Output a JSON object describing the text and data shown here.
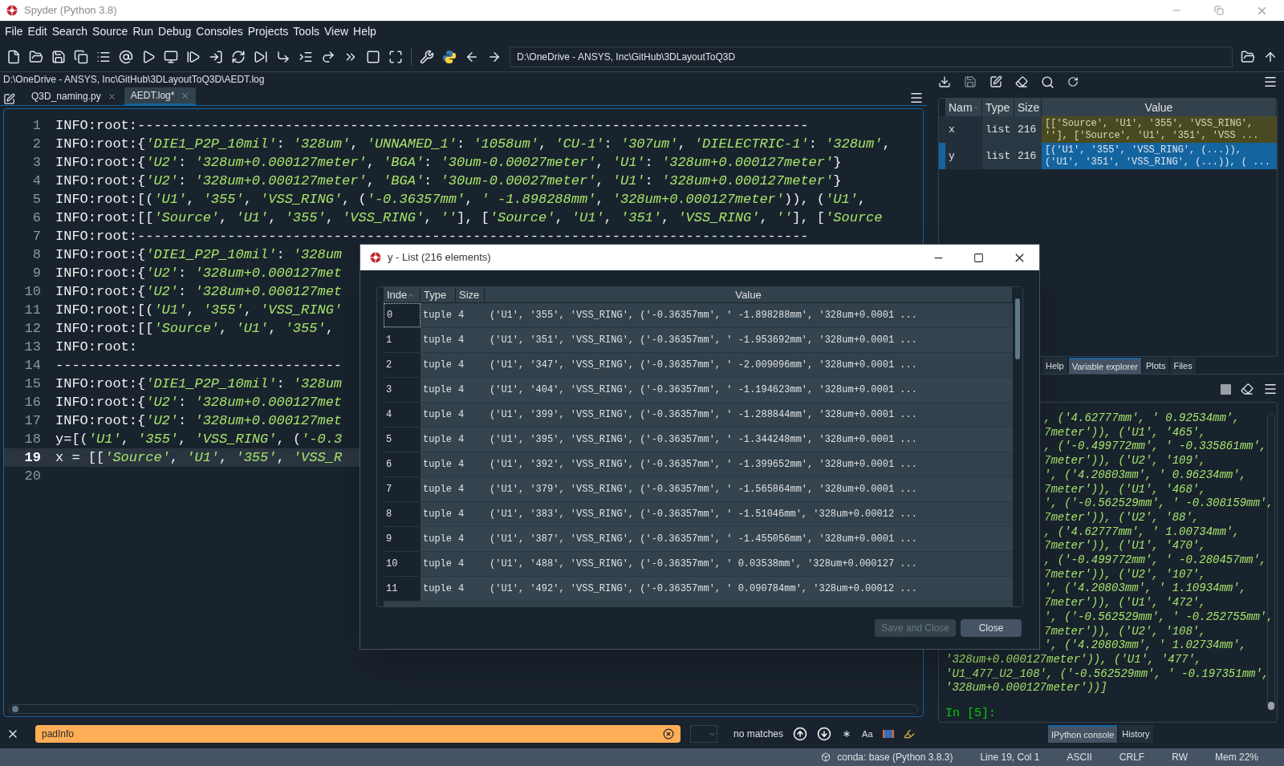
{
  "window": {
    "title": "Spyder (Python 3.8)"
  },
  "menu": [
    "File",
    "Edit",
    "Search",
    "Source",
    "Run",
    "Debug",
    "Consoles",
    "Projects",
    "Tools",
    "View",
    "Help"
  ],
  "toolbar": {
    "path": "D:\\OneDrive - ANSYS, Inc\\GitHub\\3DLayoutToQ3D"
  },
  "editor": {
    "file_path": "D:\\OneDrive - ANSYS, Inc\\GitHub\\3DLayoutToQ3D\\AEDT.log",
    "tabs": [
      {
        "label": "Q3D_naming.py",
        "selected": false
      },
      {
        "label": "AEDT.log*",
        "selected": true
      }
    ],
    "lines": [
      {
        "number": "1",
        "current": false,
        "segments": [
          {
            "text": "INFO:root:----------------------------------------------------------------------------------",
            "kind": "plain"
          }
        ]
      },
      {
        "number": "2",
        "current": false,
        "segments": [
          {
            "text": "INFO:root:{",
            "kind": "plain"
          },
          {
            "text": "'DIE1_P2P_10mil'",
            "kind": "string"
          },
          {
            "text": ": ",
            "kind": "plain"
          },
          {
            "text": "'328um'",
            "kind": "string"
          },
          {
            "text": ", ",
            "kind": "plain"
          },
          {
            "text": "'UNNAMED_1'",
            "kind": "string"
          },
          {
            "text": ": ",
            "kind": "plain"
          },
          {
            "text": "'1058um'",
            "kind": "string"
          },
          {
            "text": ", ",
            "kind": "plain"
          },
          {
            "text": "'CU-1'",
            "kind": "string"
          },
          {
            "text": ": ",
            "kind": "plain"
          },
          {
            "text": "'307um'",
            "kind": "string"
          },
          {
            "text": ", ",
            "kind": "plain"
          },
          {
            "text": "'DIELECTRIC-1'",
            "kind": "string"
          },
          {
            "text": ": ",
            "kind": "plain"
          },
          {
            "text": "'328um'",
            "kind": "string"
          },
          {
            "text": ",",
            "kind": "plain"
          }
        ]
      },
      {
        "number": "3",
        "current": false,
        "segments": [
          {
            "text": "INFO:root:{",
            "kind": "plain"
          },
          {
            "text": "'U2'",
            "kind": "string"
          },
          {
            "text": ": ",
            "kind": "plain"
          },
          {
            "text": "'328um+0.000127meter'",
            "kind": "string"
          },
          {
            "text": ", ",
            "kind": "plain"
          },
          {
            "text": "'BGA'",
            "kind": "string"
          },
          {
            "text": ": ",
            "kind": "plain"
          },
          {
            "text": "'30um-0.00027meter'",
            "kind": "string"
          },
          {
            "text": ", ",
            "kind": "plain"
          },
          {
            "text": "'U1'",
            "kind": "string"
          },
          {
            "text": ": ",
            "kind": "plain"
          },
          {
            "text": "'328um+0.000127meter'",
            "kind": "string"
          },
          {
            "text": "}",
            "kind": "plain"
          }
        ]
      },
      {
        "number": "4",
        "current": false,
        "segments": [
          {
            "text": "INFO:root:{",
            "kind": "plain"
          },
          {
            "text": "'U2'",
            "kind": "string"
          },
          {
            "text": ": ",
            "kind": "plain"
          },
          {
            "text": "'328um+0.000127meter'",
            "kind": "string"
          },
          {
            "text": ", ",
            "kind": "plain"
          },
          {
            "text": "'BGA'",
            "kind": "string"
          },
          {
            "text": ": ",
            "kind": "plain"
          },
          {
            "text": "'30um-0.00027meter'",
            "kind": "string"
          },
          {
            "text": ", ",
            "kind": "plain"
          },
          {
            "text": "'U1'",
            "kind": "string"
          },
          {
            "text": ": ",
            "kind": "plain"
          },
          {
            "text": "'328um+0.000127meter'",
            "kind": "string"
          },
          {
            "text": "}",
            "kind": "plain"
          }
        ]
      },
      {
        "number": "5",
        "current": false,
        "segments": [
          {
            "text": "INFO:root:[(",
            "kind": "plain"
          },
          {
            "text": "'U1'",
            "kind": "string"
          },
          {
            "text": ", ",
            "kind": "plain"
          },
          {
            "text": "'355'",
            "kind": "string"
          },
          {
            "text": ", ",
            "kind": "plain"
          },
          {
            "text": "'VSS_RING'",
            "kind": "string"
          },
          {
            "text": ", (",
            "kind": "plain"
          },
          {
            "text": "'-0.36357mm'",
            "kind": "string"
          },
          {
            "text": ", ",
            "kind": "plain"
          },
          {
            "text": "' -1.898288mm'",
            "kind": "string"
          },
          {
            "text": ", ",
            "kind": "plain"
          },
          {
            "text": "'328um+0.000127meter'",
            "kind": "string"
          },
          {
            "text": ")), (",
            "kind": "plain"
          },
          {
            "text": "'U1'",
            "kind": "string"
          },
          {
            "text": ",",
            "kind": "plain"
          }
        ]
      },
      {
        "number": "6",
        "current": false,
        "segments": [
          {
            "text": "INFO:root:[[",
            "kind": "plain"
          },
          {
            "text": "'Source'",
            "kind": "string"
          },
          {
            "text": ", ",
            "kind": "plain"
          },
          {
            "text": "'U1'",
            "kind": "string"
          },
          {
            "text": ", ",
            "kind": "plain"
          },
          {
            "text": "'355'",
            "kind": "string"
          },
          {
            "text": ", ",
            "kind": "plain"
          },
          {
            "text": "'VSS_RING'",
            "kind": "string"
          },
          {
            "text": ", ",
            "kind": "plain"
          },
          {
            "text": "''",
            "kind": "string"
          },
          {
            "text": "], [",
            "kind": "plain"
          },
          {
            "text": "'Source'",
            "kind": "string"
          },
          {
            "text": ", ",
            "kind": "plain"
          },
          {
            "text": "'U1'",
            "kind": "string"
          },
          {
            "text": ", ",
            "kind": "plain"
          },
          {
            "text": "'351'",
            "kind": "string"
          },
          {
            "text": ", ",
            "kind": "plain"
          },
          {
            "text": "'VSS_RING'",
            "kind": "string"
          },
          {
            "text": ", ",
            "kind": "plain"
          },
          {
            "text": "''",
            "kind": "string"
          },
          {
            "text": "], [",
            "kind": "plain"
          },
          {
            "text": "'Source",
            "kind": "string"
          }
        ]
      },
      {
        "number": "7",
        "current": false,
        "segments": [
          {
            "text": "INFO:root:----------------------------------------------------------------------------------",
            "kind": "plain"
          }
        ]
      },
      {
        "number": "8",
        "current": false,
        "segments": [
          {
            "text": "INFO:root:{",
            "kind": "plain"
          },
          {
            "text": "'DIE1_P2P_10mil'",
            "kind": "string"
          },
          {
            "text": ": ",
            "kind": "plain"
          },
          {
            "text": "'328um",
            "kind": "string"
          }
        ]
      },
      {
        "number": "9",
        "current": false,
        "segments": [
          {
            "text": "INFO:root:{",
            "kind": "plain"
          },
          {
            "text": "'U2'",
            "kind": "string"
          },
          {
            "text": ": ",
            "kind": "plain"
          },
          {
            "text": "'328um+0.000127met",
            "kind": "string"
          }
        ]
      },
      {
        "number": "10",
        "current": false,
        "segments": [
          {
            "text": "INFO:root:{",
            "kind": "plain"
          },
          {
            "text": "'U2'",
            "kind": "string"
          },
          {
            "text": ": ",
            "kind": "plain"
          },
          {
            "text": "'328um+0.000127met",
            "kind": "string"
          }
        ]
      },
      {
        "number": "11",
        "current": false,
        "segments": [
          {
            "text": "INFO:root:[(",
            "kind": "plain"
          },
          {
            "text": "'U1'",
            "kind": "string"
          },
          {
            "text": ", ",
            "kind": "plain"
          },
          {
            "text": "'355'",
            "kind": "string"
          },
          {
            "text": ", ",
            "kind": "plain"
          },
          {
            "text": "'VSS_RING'",
            "kind": "string"
          }
        ]
      },
      {
        "number": "12",
        "current": false,
        "segments": [
          {
            "text": "INFO:root:[[",
            "kind": "plain"
          },
          {
            "text": "'Source'",
            "kind": "string"
          },
          {
            "text": ", ",
            "kind": "plain"
          },
          {
            "text": "'U1'",
            "kind": "string"
          },
          {
            "text": ", ",
            "kind": "plain"
          },
          {
            "text": "'355'",
            "kind": "string"
          },
          {
            "text": ",",
            "kind": "plain"
          }
        ]
      },
      {
        "number": "13",
        "current": false,
        "segments": [
          {
            "text": "INFO:root:",
            "kind": "plain"
          }
        ]
      },
      {
        "number": "14",
        "current": false,
        "segments": [
          {
            "text": "-----------------------------------",
            "kind": "plain"
          }
        ]
      },
      {
        "number": "15",
        "current": false,
        "segments": [
          {
            "text": "INFO:root:{",
            "kind": "plain"
          },
          {
            "text": "'DIE1_P2P_10mil'",
            "kind": "string"
          },
          {
            "text": ": ",
            "kind": "plain"
          },
          {
            "text": "'328um",
            "kind": "string"
          }
        ]
      },
      {
        "number": "16",
        "current": false,
        "segments": [
          {
            "text": "INFO:root:{",
            "kind": "plain"
          },
          {
            "text": "'U2'",
            "kind": "string"
          },
          {
            "text": ": ",
            "kind": "plain"
          },
          {
            "text": "'328um+0.000127met",
            "kind": "string"
          }
        ]
      },
      {
        "number": "17",
        "current": false,
        "segments": [
          {
            "text": "INFO:root:{",
            "kind": "plain"
          },
          {
            "text": "'U2'",
            "kind": "string"
          },
          {
            "text": ": ",
            "kind": "plain"
          },
          {
            "text": "'328um+0.000127met",
            "kind": "string"
          }
        ]
      },
      {
        "number": "18",
        "current": false,
        "segments": [
          {
            "text": "y=[(",
            "kind": "plain"
          },
          {
            "text": "'U1'",
            "kind": "string"
          },
          {
            "text": ", ",
            "kind": "plain"
          },
          {
            "text": "'355'",
            "kind": "string"
          },
          {
            "text": ", ",
            "kind": "plain"
          },
          {
            "text": "'VSS_RING'",
            "kind": "string"
          },
          {
            "text": ", (",
            "kind": "plain"
          },
          {
            "text": "'-0.3",
            "kind": "string"
          }
        ]
      },
      {
        "number": "19",
        "current": true,
        "segments": [
          {
            "text": "x = [[",
            "kind": "plain"
          },
          {
            "text": "'Source'",
            "kind": "string"
          },
          {
            "text": ", ",
            "kind": "plain"
          },
          {
            "text": "'U1'",
            "kind": "string"
          },
          {
            "text": ", ",
            "kind": "plain"
          },
          {
            "text": "'355'",
            "kind": "string"
          },
          {
            "text": ", ",
            "kind": "plain"
          },
          {
            "text": "'VSS_R",
            "kind": "string"
          }
        ]
      },
      {
        "number": "20",
        "current": false
      }
    ]
  },
  "search": {
    "value": "padInfo",
    "found": false,
    "status": "no matches",
    "case_label": "Aa"
  },
  "variable_explorer": {
    "columns": [
      "Nam",
      "Type",
      "Size",
      "Value"
    ],
    "rows": [
      {
        "name": "x",
        "type": "list",
        "size": "216",
        "value": "[['Source', 'U1', '355', 'VSS_RING',\n''], ['Source', 'U1', '351', 'VSS ...",
        "selected": false
      },
      {
        "name": "y",
        "type": "list",
        "size": "216",
        "value": "[('U1', '355', 'VSS_RING', (...)),\n('U1', '351', 'VSS_RING', (...)), ( ...",
        "selected": true
      }
    ],
    "tabs": [
      {
        "label": "Help",
        "selected": false
      },
      {
        "label": "Variable explorer",
        "selected": true
      },
      {
        "label": "Plots",
        "selected": false
      },
      {
        "label": "Files",
        "selected": false
      }
    ]
  },
  "console": {
    "clipped_lines": [
      ", ('4.62777mm', ' 0.92534mm',",
      "7meter')), ('U1', '465',",
      ", ('-0.499772mm', ' -0.335861mm',",
      "7meter')), ('U2', '109',",
      "', ('4.20803mm', ' 0.96234mm',",
      "7meter')), ('U1', '468',",
      "', ('-0.562529mm', ' -0.308159mm',",
      "7meter')), ('U2', '88',",
      ", ('4.62777mm', ' 1.00734mm',",
      "7meter')), ('U1', '470',",
      ", ('-0.499772mm', ' -0.280457mm',",
      "7meter')), ('U2', '107',",
      "', ('4.20803mm', ' 1.10934mm',",
      "7meter')), ('U1', '472',",
      "', ('-0.562529mm', ' -0.252755mm',",
      "7meter')), ('U2', '108',",
      "', ('4.20803mm', ' 1.02734mm',"
    ],
    "lines": [
      "'328um+0.000127meter')), ('U1', '477',",
      "'U1_477_U2_108', ('-0.562529mm', ' -0.197351mm',",
      "'328um+0.000127meter'))]"
    ],
    "prompt": "In [5]:",
    "tabs": [
      {
        "label": "IPython console",
        "selected": true
      },
      {
        "label": "History",
        "selected": false
      }
    ]
  },
  "status_bar": [
    "conda: base (Python 3.8.3)",
    "Line 19, Col 1",
    "ASCII",
    "CRLF",
    "RW",
    "Mem 22%"
  ],
  "dialog": {
    "title": "y - List (216 elements)",
    "columns": [
      "Inde",
      "Type",
      "Size",
      "Value"
    ],
    "rows": [
      {
        "index": "0",
        "type": "tuple",
        "size": "4",
        "value": "('U1', '355', 'VSS_RING', ('-0.36357mm', ' -1.898288mm', '328um+0.0001 ...",
        "focused": true
      },
      {
        "index": "1",
        "type": "tuple",
        "size": "4",
        "value": "('U1', '351', 'VSS_RING', ('-0.36357mm', ' -1.953692mm', '328um+0.0001 ...",
        "focused": false
      },
      {
        "index": "2",
        "type": "tuple",
        "size": "4",
        "value": "('U1', '347', 'VSS_RING', ('-0.36357mm', ' -2.009096mm', '328um+0.0001 ...",
        "focused": false
      },
      {
        "index": "3",
        "type": "tuple",
        "size": "4",
        "value": "('U1', '404', 'VSS_RING', ('-0.36357mm', ' -1.194623mm', '328um+0.0001 ...",
        "focused": false
      },
      {
        "index": "4",
        "type": "tuple",
        "size": "4",
        "value": "('U1', '399', 'VSS_RING', ('-0.36357mm', ' -1.288844mm', '328um+0.0001 ...",
        "focused": false
      },
      {
        "index": "5",
        "type": "tuple",
        "size": "4",
        "value": "('U1', '395', 'VSS_RING', ('-0.36357mm', ' -1.344248mm', '328um+0.0001 ...",
        "focused": false
      },
      {
        "index": "6",
        "type": "tuple",
        "size": "4",
        "value": "('U1', '392', 'VSS_RING', ('-0.36357mm', ' -1.399652mm', '328um+0.0001 ...",
        "focused": false
      },
      {
        "index": "7",
        "type": "tuple",
        "size": "4",
        "value": "('U1', '379', 'VSS_RING', ('-0.36357mm', ' -1.565864mm', '328um+0.0001 ...",
        "focused": false
      },
      {
        "index": "8",
        "type": "tuple",
        "size": "4",
        "value": "('U1', '383', 'VSS_RING', ('-0.36357mm', ' -1.51046mm', '328um+0.00012 ...",
        "focused": false
      },
      {
        "index": "9",
        "type": "tuple",
        "size": "4",
        "value": "('U1', '387', 'VSS_RING', ('-0.36357mm', ' -1.455056mm', '328um+0.0001 ...",
        "focused": false
      },
      {
        "index": "10",
        "type": "tuple",
        "size": "4",
        "value": "('U1', '488', 'VSS_RING', ('-0.36357mm', ' 0.03538mm', '328um+0.000127 ...",
        "focused": false
      },
      {
        "index": "11",
        "type": "tuple",
        "size": "4",
        "value": "('U1', '492', 'VSS_RING', ('-0.36357mm', ' 0.090784mm', '328um+0.00012 ...",
        "focused": false
      }
    ],
    "buttons": [
      {
        "label": "Save and Close",
        "disabled": true
      },
      {
        "label": "Close",
        "disabled": false
      }
    ]
  }
}
